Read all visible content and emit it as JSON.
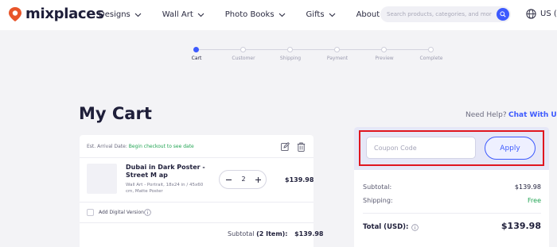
{
  "brand": {
    "name": "mixplaces",
    "accent": "#3d5afe",
    "mark_color": "#e8552a"
  },
  "nav": {
    "items": [
      {
        "label": "Designs"
      },
      {
        "label": "Wall Art"
      },
      {
        "label": "Photo Books"
      },
      {
        "label": "Gifts"
      },
      {
        "label": "About"
      }
    ]
  },
  "search": {
    "placeholder": "Search products, categories, and more!"
  },
  "region": {
    "label": "US (U"
  },
  "steps": [
    {
      "label": "Cart",
      "active": true
    },
    {
      "label": "Customer",
      "active": false
    },
    {
      "label": "Shipping",
      "active": false
    },
    {
      "label": "Payment",
      "active": false
    },
    {
      "label": "Preview",
      "active": false
    },
    {
      "label": "Complete",
      "active": false
    }
  ],
  "page": {
    "title": "My Cart",
    "need_help": "Need Help?",
    "chat_link": "Chat With Us"
  },
  "cart": {
    "arrival_prefix": "Est. Arrival Date:",
    "arrival_link": "Begin checkout to see date",
    "item": {
      "name": "Dubai in Dark Poster - Street M ap",
      "description": "Wall Art - Portrait, 18x24 in / 45x60 cm, Matte Poster",
      "quantity": "2",
      "price": "$139.98"
    },
    "digital_label": "Add Digital Version",
    "subtotal_label": "Subtotal",
    "subtotal_count": "(2 Item):",
    "subtotal_amount": "$139.98"
  },
  "summary": {
    "coupon_placeholder": "Coupon Code",
    "apply_label": "Apply",
    "subtotal_label": "Subtotal:",
    "subtotal_value": "$139.98",
    "shipping_label": "Shipping:",
    "shipping_value": "Free",
    "total_label": "Total (USD):",
    "total_value": "$139.98"
  },
  "colors": {
    "highlight": "#e0161f",
    "green": "#21a453"
  }
}
